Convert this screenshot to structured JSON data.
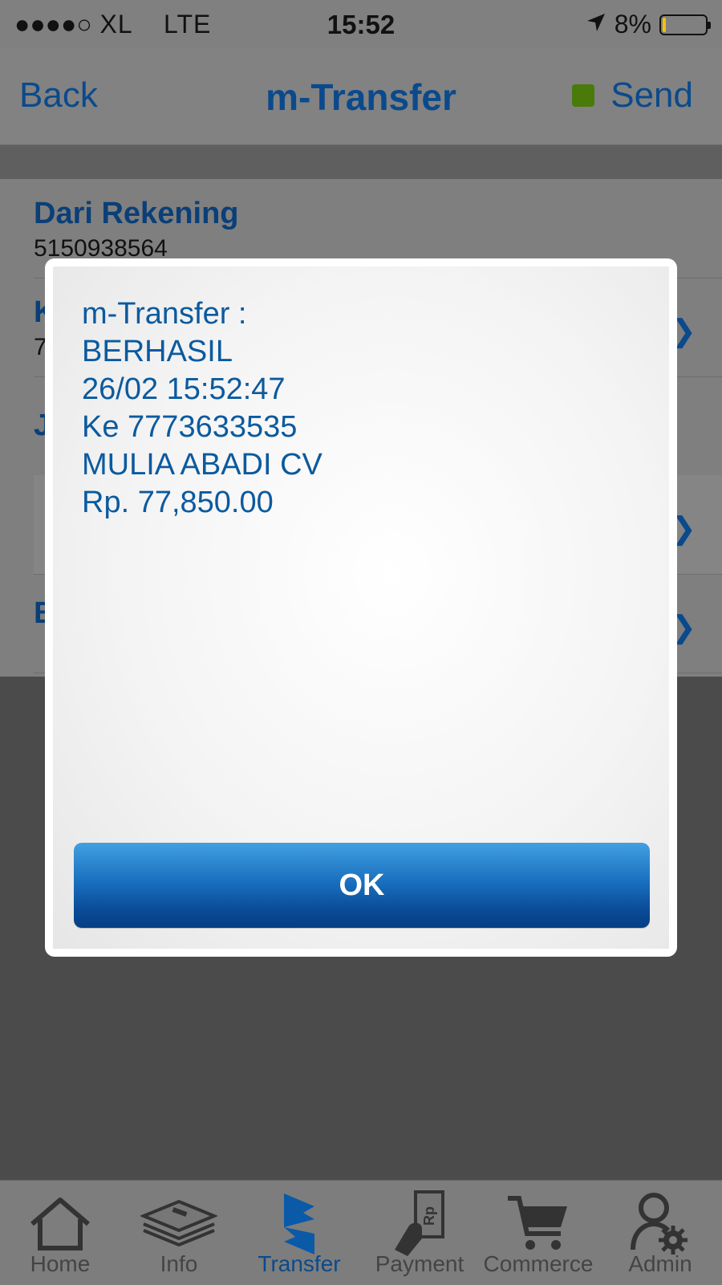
{
  "status_bar": {
    "carrier": "XL",
    "network": "LTE",
    "time": "15:52",
    "battery_percent": "8%",
    "battery_level": 0.08,
    "signal_dots": "●●●●○"
  },
  "nav": {
    "back_label": "Back",
    "title": "m-Transfer",
    "send_label": "Send",
    "send_indicator_color": "#4a7a0a"
  },
  "form": {
    "rows": [
      {
        "label": "Dari Rekening",
        "value": "5150938564"
      },
      {
        "label": "K",
        "value": "7"
      },
      {
        "label": "J",
        "value": ""
      },
      {
        "label": "",
        "value": ""
      },
      {
        "label": "B",
        "value": ""
      }
    ]
  },
  "dialog": {
    "lines": [
      "m-Transfer :",
      "BERHASIL",
      "26/02 15:52:47",
      "Ke 7773633535",
      "MULIA ABADI CV",
      "Rp. 77,850.00"
    ],
    "ok_label": "OK"
  },
  "tabbar": {
    "active_index": 2,
    "items": [
      {
        "label": "Home",
        "icon": "home-icon"
      },
      {
        "label": "Info",
        "icon": "info-stack-icon"
      },
      {
        "label": "Transfer",
        "icon": "transfer-icon"
      },
      {
        "label": "Payment",
        "icon": "payment-icon"
      },
      {
        "label": "Commerce",
        "icon": "cart-icon"
      },
      {
        "label": "Admin",
        "icon": "admin-icon"
      }
    ]
  },
  "colors": {
    "accent": "#0a4a8c",
    "dialog_text": "#0b5a9e",
    "ok_button_top": "#42a0e0",
    "ok_button_bottom": "#063f84"
  }
}
